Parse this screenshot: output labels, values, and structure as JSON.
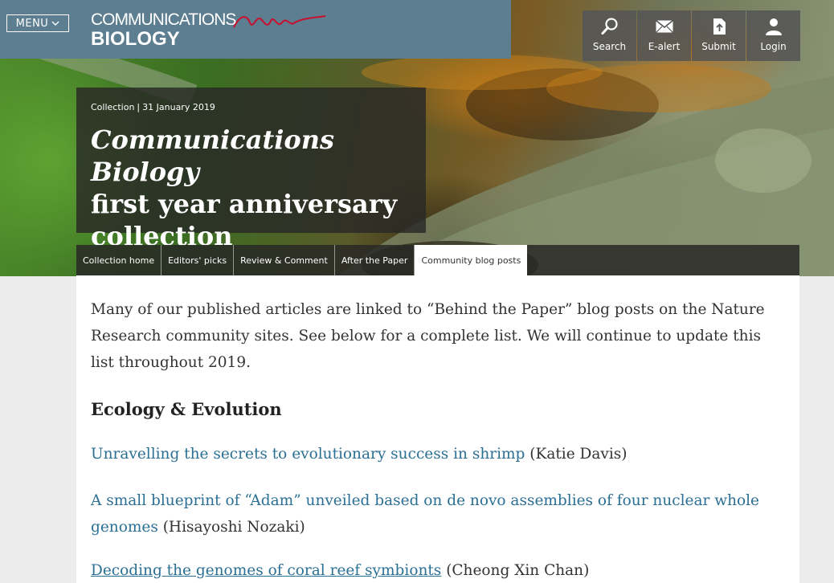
{
  "header": {
    "menu_label": "MENU",
    "logo_line1": "COMMUNICATIONS",
    "logo_line2": "BIOLOGY",
    "actions": [
      {
        "label": "Search",
        "icon": "search-icon"
      },
      {
        "label": "E-alert",
        "icon": "mail-icon"
      },
      {
        "label": "Submit",
        "icon": "upload-document-icon"
      },
      {
        "label": "Login",
        "icon": "user-icon"
      }
    ]
  },
  "hero": {
    "meta_type": "Collection",
    "meta_date": "31 January 2019",
    "title_italic": "Communications Biology",
    "title_rest_line1": "first year anniversary",
    "title_rest_line2": "collection"
  },
  "tabs": [
    {
      "label": "Collection home",
      "active": false
    },
    {
      "label": "Editors' picks",
      "active": false
    },
    {
      "label": "Review & Comment",
      "active": false
    },
    {
      "label": "After the Paper",
      "active": false
    },
    {
      "label": "Community blog posts",
      "active": true
    }
  ],
  "content": {
    "intro": "Many of our published articles are linked to “Behind the Paper” blog posts on the Nature Research community sites. See below for a complete list. We will continue to update this list throughout 2019.",
    "section_heading": "Ecology & Evolution",
    "entries": [
      {
        "link": "Unravelling the secrets to evolutionary success in shrimp",
        "author": "(Katie Davis)"
      },
      {
        "link": "A small blueprint of “Adam” unveiled based on de novo assemblies of four nuclear whole genomes",
        "author": "(Hisayoshi Nozaki)"
      },
      {
        "link": "Decoding the genomes of coral reef symbionts",
        "author": "(Cheong Xin Chan)"
      }
    ]
  },
  "colors": {
    "topbar": "#5d7e90",
    "link": "#2b6f94",
    "logo_mark": "#c8102e"
  }
}
